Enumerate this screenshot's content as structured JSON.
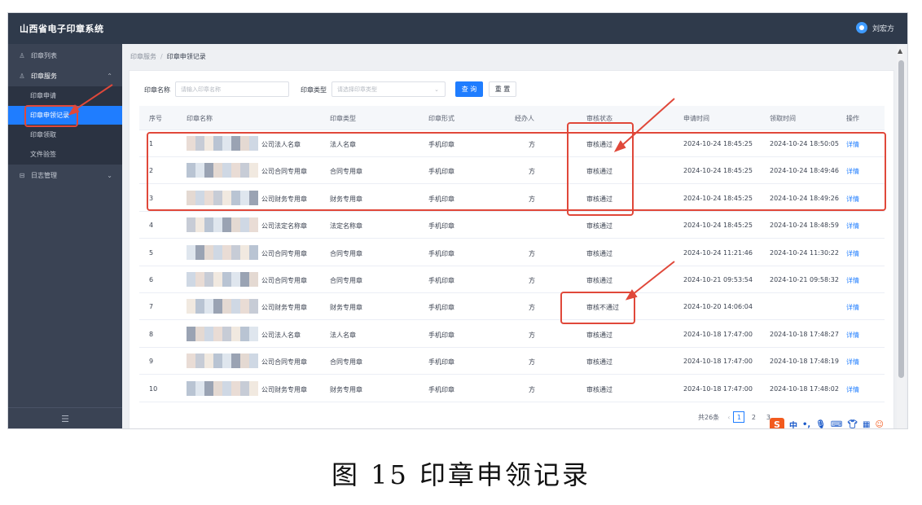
{
  "app": {
    "title": "山西省电子印章系统",
    "user_name": "刘宏方"
  },
  "sidebar": {
    "items": [
      {
        "label": "印章列表",
        "icon": "user-icon"
      },
      {
        "label": "印章服务",
        "icon": "user-icon",
        "expanded": true
      },
      {
        "label": "日志管理",
        "icon": "log-icon",
        "expanded": false
      }
    ],
    "sub_items": [
      {
        "label": "印章申请",
        "active": false
      },
      {
        "label": "印章申领记录",
        "active": true
      },
      {
        "label": "印章领取",
        "active": false
      },
      {
        "label": "文件验签",
        "active": false
      }
    ],
    "collapse_icon": "menu-icon"
  },
  "breadcrumb": {
    "parent": "印章服务",
    "current": "印章申领记录"
  },
  "filters": {
    "name_label": "印章名称",
    "name_placeholder": "请输入印章名称",
    "type_label": "印章类型",
    "type_placeholder": "请选择印章类型",
    "search_label": "查 询",
    "reset_label": "重 置"
  },
  "table": {
    "headers": [
      "序号",
      "印章名称",
      "印章类型",
      "印章形式",
      "经办人",
      "审核状态",
      "申请时间",
      "领取时间",
      "操作"
    ],
    "rows": [
      {
        "no": "1",
        "name": "公司法人名章",
        "type": "法人名章",
        "form": "手机印章",
        "handler": "方",
        "status": "审核通过",
        "apply": "2024-10-24 18:45:25",
        "receive": "2024-10-24 18:50:05",
        "action": "详情"
      },
      {
        "no": "2",
        "name": "公司合同专用章",
        "type": "合同专用章",
        "form": "手机印章",
        "handler": "方",
        "status": "审核通过",
        "apply": "2024-10-24 18:45:25",
        "receive": "2024-10-24 18:49:46",
        "action": "详情"
      },
      {
        "no": "3",
        "name": "公司财务专用章",
        "type": "财务专用章",
        "form": "手机印章",
        "handler": "方",
        "status": "审核通过",
        "apply": "2024-10-24 18:45:25",
        "receive": "2024-10-24 18:49:26",
        "action": "详情"
      },
      {
        "no": "4",
        "name": "公司法定名称章",
        "type": "法定名称章",
        "form": "手机印章",
        "handler": "",
        "status": "审核通过",
        "apply": "2024-10-24 18:45:25",
        "receive": "2024-10-24 18:48:59",
        "action": "详情"
      },
      {
        "no": "5",
        "name": "公司合同专用章",
        "type": "合同专用章",
        "form": "手机印章",
        "handler": "方",
        "status": "审核通过",
        "apply": "2024-10-24 11:21:46",
        "receive": "2024-10-24 11:30:22",
        "action": "详情"
      },
      {
        "no": "6",
        "name": "公司合同专用章",
        "type": "合同专用章",
        "form": "手机印章",
        "handler": "方",
        "status": "审核通过",
        "apply": "2024-10-21 09:53:54",
        "receive": "2024-10-21 09:58:32",
        "action": "详情"
      },
      {
        "no": "7",
        "name": "公司财务专用章",
        "type": "财务专用章",
        "form": "手机印章",
        "handler": "方",
        "status": "审核不通过",
        "apply": "2024-10-20 14:06:04",
        "receive": "",
        "action": "详情"
      },
      {
        "no": "8",
        "name": "公司法人名章",
        "type": "法人名章",
        "form": "手机印章",
        "handler": "方",
        "status": "审核通过",
        "apply": "2024-10-18 17:47:00",
        "receive": "2024-10-18 17:48:27",
        "action": "详情"
      },
      {
        "no": "9",
        "name": "公司合同专用章",
        "type": "合同专用章",
        "form": "手机印章",
        "handler": "方",
        "status": "审核通过",
        "apply": "2024-10-18 17:47:00",
        "receive": "2024-10-18 17:48:19",
        "action": "详情"
      },
      {
        "no": "10",
        "name": "公司财务专用章",
        "type": "财务专用章",
        "form": "手机印章",
        "handler": "方",
        "status": "审核通过",
        "apply": "2024-10-18 17:47:00",
        "receive": "2024-10-18 17:48:02",
        "action": "详情"
      }
    ]
  },
  "pagination": {
    "total": "共26条",
    "pages": [
      "1",
      "2",
      "3"
    ],
    "current": "1"
  },
  "ime_toolbar": {
    "logo": "S",
    "lang": "中",
    "punct": "•,",
    "icons": [
      "mic-icon",
      "keyboard-icon",
      "shirt-icon",
      "grid-icon",
      "face-icon"
    ]
  },
  "caption": "图 15  印章申领记录",
  "colors": {
    "header_bg": "#2f3a4b",
    "sidebar_bg": "#3a4354",
    "accent": "#1f7dff",
    "annotation": "#e0483a"
  }
}
